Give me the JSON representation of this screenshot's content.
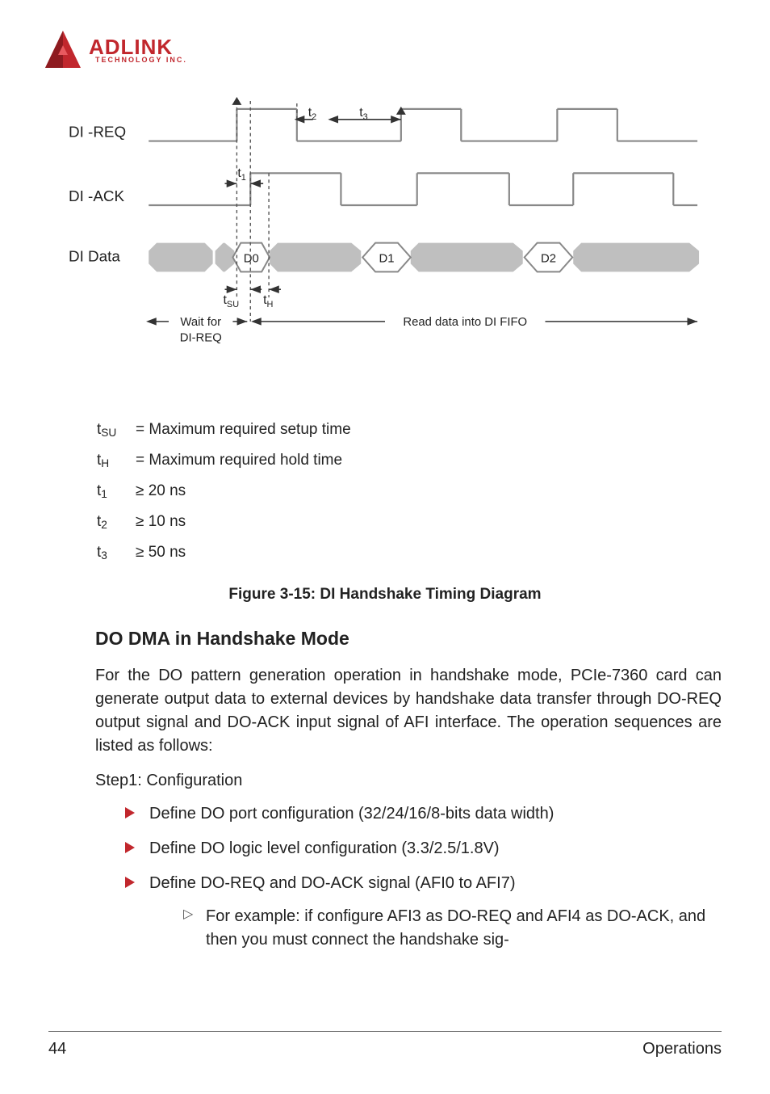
{
  "logo": {
    "main": "ADLINK",
    "sub": "TECHNOLOGY INC."
  },
  "diagram": {
    "signals": {
      "di_req": "DI -REQ",
      "di_ack": "DI -ACK",
      "di_data": "DI Data"
    },
    "markers": {
      "t1": "t",
      "t1_sub": "1",
      "t2": "t",
      "t2_sub": "2",
      "t3": "t",
      "t3_sub": "3",
      "tsu": "t",
      "tsu_sub": "SU",
      "th": "t",
      "th_sub": "H"
    },
    "data_cells": {
      "d0": "D0",
      "d1": "D1",
      "d2": "D2"
    },
    "annotations": {
      "wait": "Wait for",
      "wait_line2": "DI-REQ",
      "read": "Read data into DI FIFO"
    }
  },
  "params": {
    "tsu": "= Maximum required setup time",
    "th": "= Maximum required hold time",
    "t1": "≥ 20 ns",
    "t2": "≥ 10 ns",
    "t3": "≥ 50 ns"
  },
  "figure_caption": "Figure 3-15: DI Handshake Timing Diagram",
  "section_heading": "DO DMA in Handshake Mode",
  "body_para": "For the DO pattern generation operation in handshake mode, PCIe-7360 card can generate output data to external devices by handshake data transfer through DO-REQ output signal and DO-ACK input signal of AFI interface. The operation sequences are listed as follows:",
  "step1": "Step1: Configuration",
  "bullets": {
    "b1": "Define DO port configuration (32/24/16/8-bits data width)",
    "b2": "Define DO logic level configuration (3.3/2.5/1.8V)",
    "b3": "Define DO-REQ and DO-ACK signal (AFI0 to AFI7)",
    "b3_sub": "For example: if configure AFI3 as DO-REQ and AFI4 as DO-ACK, and then you must connect the handshake sig-"
  },
  "footer": {
    "page": "44",
    "section": "Operations"
  }
}
